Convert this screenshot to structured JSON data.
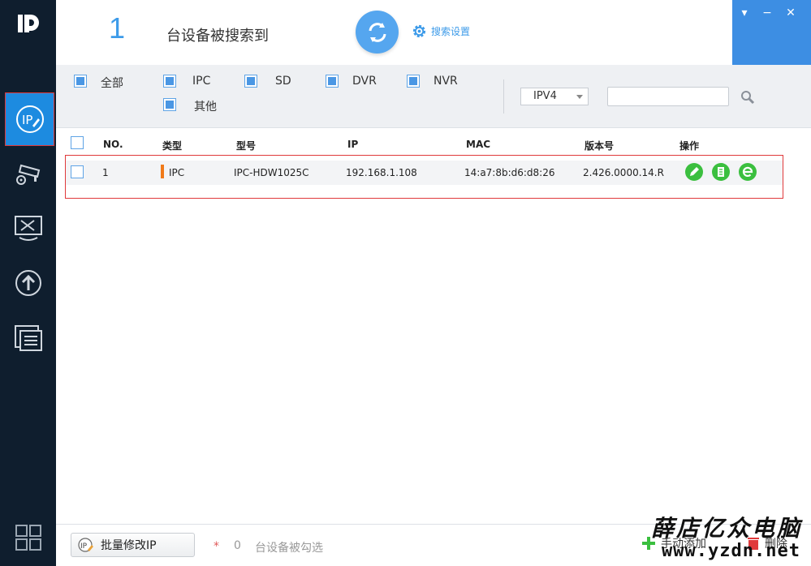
{
  "header": {
    "device_count": "1",
    "found_text": "台设备被搜索到",
    "settings_label": "搜索设置"
  },
  "window_controls": {
    "menu": "▾",
    "minimize": "−",
    "close": "✕"
  },
  "filters": {
    "all_label": "全部",
    "types": [
      "IPC",
      "SD",
      "DVR",
      "NVR",
      "其他"
    ],
    "ip_version": "IPV4",
    "search_placeholder": ""
  },
  "table": {
    "headers": {
      "no": "NO.",
      "type": "类型",
      "model": "型号",
      "ip": "IP",
      "mac": "MAC",
      "version": "版本号",
      "ops": "操作"
    },
    "rows": [
      {
        "no": "1",
        "type": "IPC",
        "model": "IPC-HDW1025C",
        "ip": "192.168.1.108",
        "mac": "14:a7:8b:d6:d8:26",
        "version": "2.426.0000.14.R"
      }
    ]
  },
  "footer": {
    "batch_label": "批量修改IP",
    "selected_star": "*",
    "selected_count": "0",
    "selected_text": "台设备被勾选",
    "add_label": "手动添加",
    "delete_label": "删除"
  },
  "watermark": {
    "line1": "薛店亿众电脑",
    "line2": "www.yzdn.net"
  },
  "colors": {
    "accent": "#3d9be9",
    "sidebar": "#0f1e2e",
    "active": "#1d8be0",
    "highlight": "#e0393b",
    "op_green": "#3bbf3f",
    "type_orange": "#f07a19"
  }
}
